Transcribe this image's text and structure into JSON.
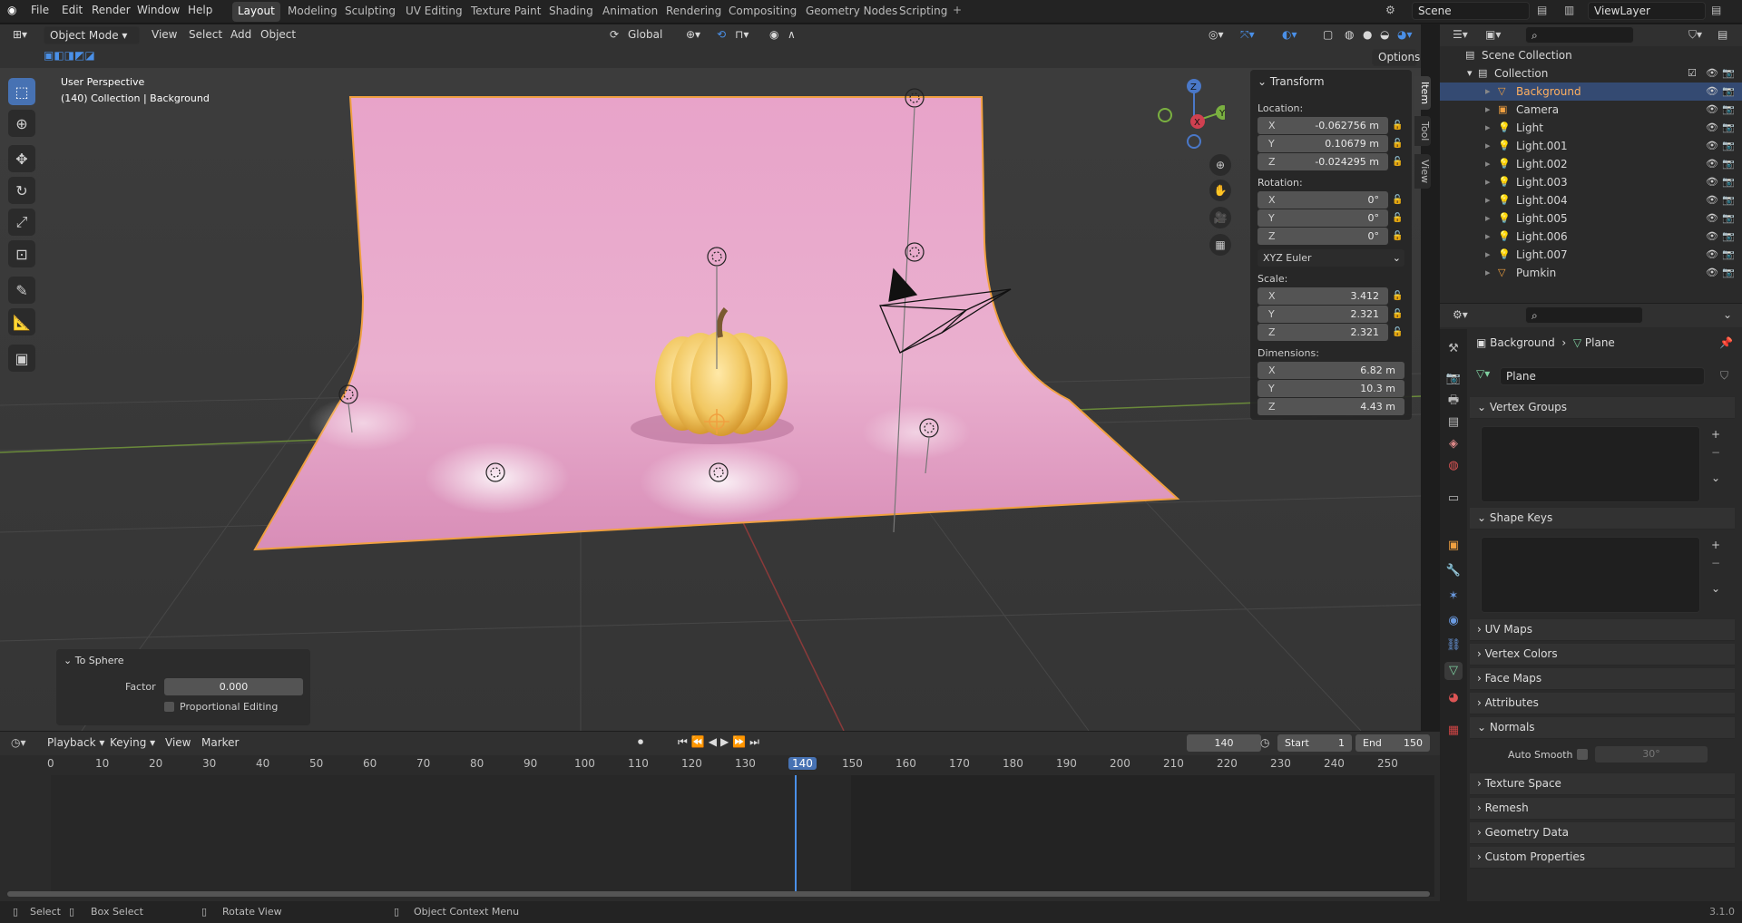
{
  "menu": {
    "file": "File",
    "edit": "Edit",
    "render": "Render",
    "window": "Window",
    "help": "Help"
  },
  "workspaces": [
    "Layout",
    "Modeling",
    "Sculpting",
    "UV Editing",
    "Texture Paint",
    "Shading",
    "Animation",
    "Rendering",
    "Compositing",
    "Geometry Nodes",
    "Scripting"
  ],
  "scene_name": "Scene",
  "view_layer": "ViewLayer",
  "viewport": {
    "mode": "Object Mode",
    "menus": [
      "View",
      "Select",
      "Add",
      "Object"
    ],
    "orientation": "Global",
    "options": "Options",
    "overlay_line1": "User Perspective",
    "overlay_line2": "(140) Collection | Background",
    "gizmo_axes": {
      "x": "X",
      "y": "Y",
      "z": "Z"
    }
  },
  "npanel": {
    "title": "Transform",
    "location_label": "Location:",
    "location": [
      {
        "ax": "X",
        "v": "-0.062756 m"
      },
      {
        "ax": "Y",
        "v": "0.10679 m"
      },
      {
        "ax": "Z",
        "v": "-0.024295 m"
      }
    ],
    "rotation_label": "Rotation:",
    "rotation": [
      {
        "ax": "X",
        "v": "0°"
      },
      {
        "ax": "Y",
        "v": "0°"
      },
      {
        "ax": "Z",
        "v": "0°"
      }
    ],
    "rotation_mode": "XYZ Euler",
    "scale_label": "Scale:",
    "scale": [
      {
        "ax": "X",
        "v": "3.412"
      },
      {
        "ax": "Y",
        "v": "2.321"
      },
      {
        "ax": "Z",
        "v": "2.321"
      }
    ],
    "dimensions_label": "Dimensions:",
    "dimensions": [
      {
        "ax": "X",
        "v": "6.82 m"
      },
      {
        "ax": "Y",
        "v": "10.3 m"
      },
      {
        "ax": "Z",
        "v": "4.43 m"
      }
    ],
    "tabs": [
      "Item",
      "Tool",
      "View"
    ]
  },
  "operator": {
    "title": "To Sphere",
    "factor_label": "Factor",
    "factor": "0.000",
    "prop_edit": "Proportional Editing"
  },
  "outliner": {
    "scene_collection": "Scene Collection",
    "collection": "Collection",
    "items": [
      "Background",
      "Camera",
      "Light",
      "Light.001",
      "Light.002",
      "Light.003",
      "Light.004",
      "Light.005",
      "Light.006",
      "Light.007",
      "Pumkin"
    ]
  },
  "properties": {
    "breadcrumb_object": "Background",
    "breadcrumb_data": "Plane",
    "mesh_name": "Plane",
    "sections": [
      "Vertex Groups",
      "Shape Keys",
      "UV Maps",
      "Vertex Colors",
      "Face Maps",
      "Attributes",
      "Normals",
      "Texture Space",
      "Remesh",
      "Geometry Data",
      "Custom Properties"
    ],
    "auto_smooth_label": "Auto Smooth",
    "auto_smooth_angle": "30°"
  },
  "timeline": {
    "menus": [
      "Playback",
      "Keying",
      "View",
      "Marker"
    ],
    "current_frame": "140",
    "start_label": "Start",
    "start": "1",
    "end_label": "End",
    "end": "150",
    "ticks": [
      "0",
      "10",
      "20",
      "30",
      "40",
      "50",
      "60",
      "70",
      "80",
      "90",
      "100",
      "110",
      "120",
      "130",
      "140",
      "150",
      "160",
      "170",
      "180",
      "190",
      "200",
      "210",
      "220",
      "230",
      "240",
      "250"
    ]
  },
  "status": {
    "select": "Select",
    "box_select": "Box Select",
    "rotate_view": "Rotate View",
    "context_menu": "Object Context Menu",
    "version": "3.1.0"
  },
  "colors": {
    "accent": "#4772b3",
    "backdrop": "#e59bc2",
    "pumpkin": "#f1c761",
    "selection_outline": "#f0a040"
  }
}
